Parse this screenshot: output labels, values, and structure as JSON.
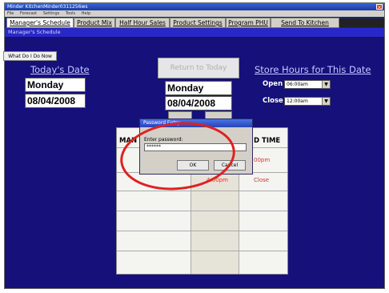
{
  "app": {
    "title": "Minder KitchenMinder0311256ws",
    "close_icon": "close-icon"
  },
  "menu": [
    "File",
    "Forecast",
    "Settings",
    "Tools",
    "Help"
  ],
  "tabs": [
    {
      "label": "Manager's Schedule",
      "active": true
    },
    {
      "label": "Product Mix",
      "active": false
    },
    {
      "label": "Half Hour Sales",
      "active": false
    },
    {
      "label": "Product Settings",
      "active": false
    },
    {
      "label": "Program PHU",
      "active": false
    },
    {
      "label": "Send To Kitchen Minder",
      "active": false
    }
  ],
  "section": {
    "title": "Manager's Schedule"
  },
  "help_button": "What Do I Do Now",
  "today": {
    "heading": "Today's Date",
    "day": "Monday",
    "date": "08/04/2008"
  },
  "return": {
    "label": "Return to Today",
    "day": "Monday",
    "date": "08/04/2008"
  },
  "store_hours": {
    "heading": "Store Hours for This Date",
    "open_label": "Open",
    "open_value": "06:00am",
    "close_label": "Close",
    "close_value": "12:00am"
  },
  "grid": {
    "header_left": "MAN",
    "header_right": "D TIME",
    "right_row1": "00pm",
    "mid_row2": "4:00pm",
    "right_row2": "Close"
  },
  "dialog": {
    "title": "Password Entry",
    "prompt": "Enter password:",
    "value": "******",
    "ok": "OK",
    "cancel": "Cancel"
  },
  "colors": {
    "background": "#15107a",
    "annotation": "#e02020"
  }
}
